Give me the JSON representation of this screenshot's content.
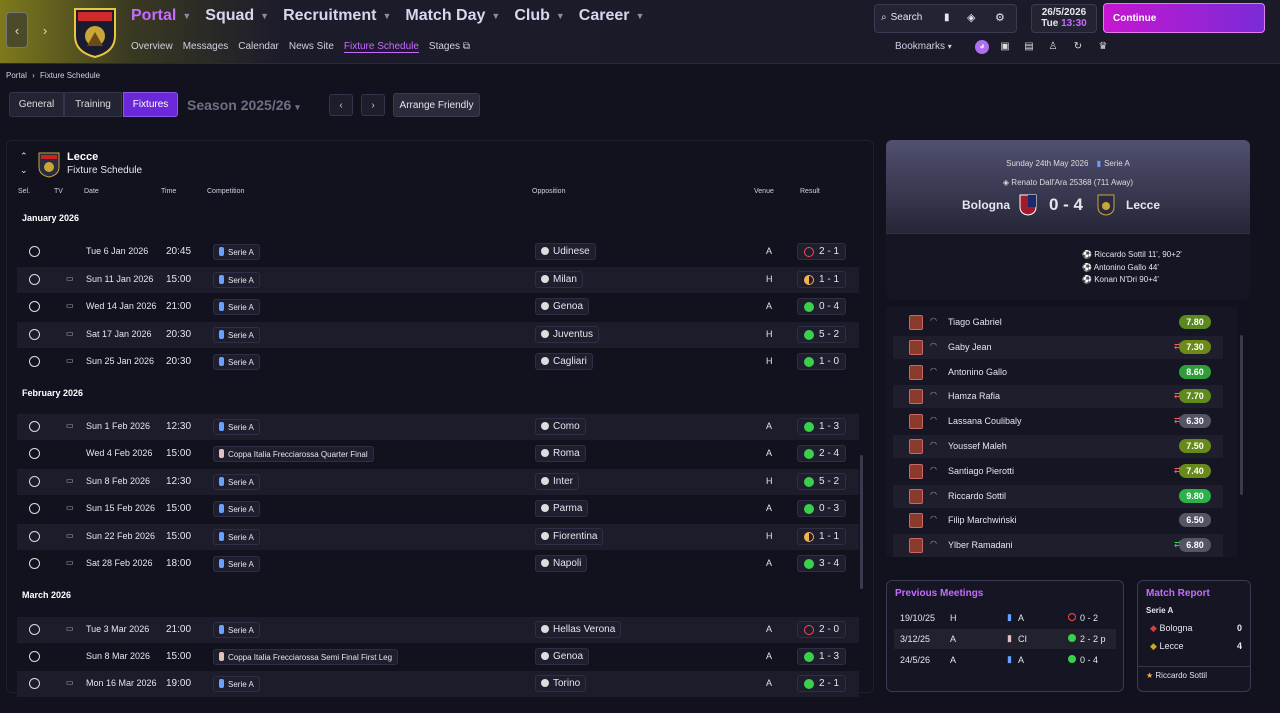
{
  "topbar": {
    "nav": [
      {
        "label": "Portal",
        "active": true
      },
      {
        "label": "Squad"
      },
      {
        "label": "Recruitment"
      },
      {
        "label": "Match Day"
      },
      {
        "label": "Club"
      },
      {
        "label": "Career"
      }
    ],
    "subnav": [
      "Overview",
      "Messages",
      "Calendar",
      "News Site",
      "Fixture Schedule",
      "Stages"
    ],
    "search_label": "Search",
    "date": "26/5/2026",
    "day_time": "Tue",
    "time": "13:30",
    "continue_label": "Continue",
    "bookmarks_label": "Bookmarks"
  },
  "breadcrumb": {
    "root": "Portal",
    "current": "Fixture Schedule"
  },
  "toolbar": {
    "tabs": [
      "General",
      "Training",
      "Fixtures"
    ],
    "season": "Season 2025/26",
    "arrange": "Arrange Friendly"
  },
  "fixtures": {
    "team": "Lecce",
    "subtitle": "Fixture Schedule",
    "columns": {
      "sel": "Sel.",
      "tv": "TV",
      "date": "Date",
      "time": "Time",
      "comp": "Competition",
      "opp": "Opposition",
      "venue": "Venue",
      "result": "Result"
    },
    "months": [
      "January 2026",
      "February 2026",
      "March 2026"
    ],
    "rows": [
      {
        "tv": false,
        "date": "Tue 6 Jan 2026",
        "time": "20:45",
        "comp": "Serie A",
        "opp": "Udinese",
        "venue": "A",
        "result": "2 - 1",
        "outcome": "L"
      },
      {
        "tv": true,
        "date": "Sun 11 Jan 2026",
        "time": "15:00",
        "comp": "Serie A",
        "opp": "Milan",
        "venue": "H",
        "result": "1 - 1",
        "outcome": "D"
      },
      {
        "tv": true,
        "date": "Wed 14 Jan 2026",
        "time": "21:00",
        "comp": "Serie A",
        "opp": "Genoa",
        "venue": "A",
        "result": "0 - 4",
        "outcome": "W"
      },
      {
        "tv": true,
        "date": "Sat 17 Jan 2026",
        "time": "20:30",
        "comp": "Serie A",
        "opp": "Juventus",
        "venue": "H",
        "result": "5 - 2",
        "outcome": "W"
      },
      {
        "tv": true,
        "date": "Sun 25 Jan 2026",
        "time": "20:30",
        "comp": "Serie A",
        "opp": "Cagliari",
        "venue": "H",
        "result": "1 - 0",
        "outcome": "W"
      },
      {
        "tv": true,
        "date": "Sun 1 Feb 2026",
        "time": "12:30",
        "comp": "Serie A",
        "opp": "Como",
        "venue": "A",
        "result": "1 - 3",
        "outcome": "W"
      },
      {
        "tv": false,
        "date": "Wed 4 Feb 2026",
        "time": "15:00",
        "comp": "Coppa Italia Frecciarossa Quarter Final",
        "opp": "Roma",
        "venue": "A",
        "result": "2 - 4",
        "outcome": "W"
      },
      {
        "tv": true,
        "date": "Sun 8 Feb 2026",
        "time": "12:30",
        "comp": "Serie A",
        "opp": "Inter",
        "venue": "H",
        "result": "5 - 2",
        "outcome": "W"
      },
      {
        "tv": true,
        "date": "Sun 15 Feb 2026",
        "time": "15:00",
        "comp": "Serie A",
        "opp": "Parma",
        "venue": "A",
        "result": "0 - 3",
        "outcome": "W"
      },
      {
        "tv": true,
        "date": "Sun 22 Feb 2026",
        "time": "15:00",
        "comp": "Serie A",
        "opp": "Fiorentina",
        "venue": "H",
        "result": "1 - 1",
        "outcome": "D"
      },
      {
        "tv": true,
        "date": "Sat 28 Feb 2026",
        "time": "18:00",
        "comp": "Serie A",
        "opp": "Napoli",
        "venue": "A",
        "result": "3 - 4",
        "outcome": "W"
      },
      {
        "tv": true,
        "date": "Tue 3 Mar 2026",
        "time": "21:00",
        "comp": "Serie A",
        "opp": "Hellas Verona",
        "venue": "A",
        "result": "2 - 0",
        "outcome": "L"
      },
      {
        "tv": false,
        "date": "Sun 8 Mar 2026",
        "time": "15:00",
        "comp": "Coppa Italia Frecciarossa Semi Final First Leg",
        "opp": "Genoa",
        "venue": "A",
        "result": "1 - 3",
        "outcome": "W"
      },
      {
        "tv": true,
        "date": "Mon 16 Mar 2026",
        "time": "19:00",
        "comp": "Serie A",
        "opp": "Torino",
        "venue": "A",
        "result": "2 - 1",
        "outcome": "W"
      }
    ]
  },
  "match": {
    "date": "Sunday 24th May 2026",
    "competition": "Serie A",
    "stadium": "Renato Dall'Ara",
    "attendance": "25368",
    "away_fans": "(711 Away)",
    "home": "Bologna",
    "away": "Lecce",
    "score": "0 - 4",
    "scorers": [
      "Riccardo Sottil 11', 90+2'",
      "Antonino Gallo 44'",
      "Konan N'Dri 90+4'"
    ]
  },
  "ratings": [
    {
      "name": "Tiago Gabriel",
      "rating": "7.80",
      "color": "#5a8a1e"
    },
    {
      "name": "Gaby Jean",
      "rating": "7.30",
      "color": "#6b8a18"
    },
    {
      "name": "Antonino Gallo",
      "rating": "8.60",
      "color": "#2f9e3a"
    },
    {
      "name": "Hamza Rafia",
      "rating": "7.70",
      "color": "#5f8a1c"
    },
    {
      "name": "Lassana Coulibaly",
      "rating": "6.30",
      "color": "#555566"
    },
    {
      "name": "Youssef Maleh",
      "rating": "7.50",
      "color": "#658a1a"
    },
    {
      "name": "Santiago Pierotti",
      "rating": "7.40",
      "color": "#688a19"
    },
    {
      "name": "Riccardo Sottil",
      "rating": "9.80",
      "color": "#2bb04a"
    },
    {
      "name": "Filip Marchwiński",
      "rating": "6.50",
      "color": "#555566"
    },
    {
      "name": "Ylber Ramadani",
      "rating": "6.80",
      "color": "#555566"
    }
  ],
  "previous": {
    "title": "Previous Meetings",
    "rows": [
      {
        "date": "19/10/25",
        "venue": "H",
        "comp": "A",
        "result": "0 - 2",
        "outcome": "L"
      },
      {
        "date": "3/12/25",
        "venue": "A",
        "comp": "CI",
        "result": "2 - 2 p",
        "outcome": "W"
      },
      {
        "date": "24/5/26",
        "venue": "A",
        "comp": "A",
        "result": "0 - 4",
        "outcome": "W"
      }
    ]
  },
  "report": {
    "title": "Match Report",
    "comp": "Serie A",
    "home": "Bologna",
    "home_score": "0",
    "away": "Lecce",
    "away_score": "4",
    "potm": "Riccardo Sottil"
  },
  "colors": {
    "accent": "#c66bff",
    "active_tab": "#6a28d8",
    "win": "#3ad04b",
    "loss": "#ff4848",
    "draw": "#f6b24a"
  }
}
